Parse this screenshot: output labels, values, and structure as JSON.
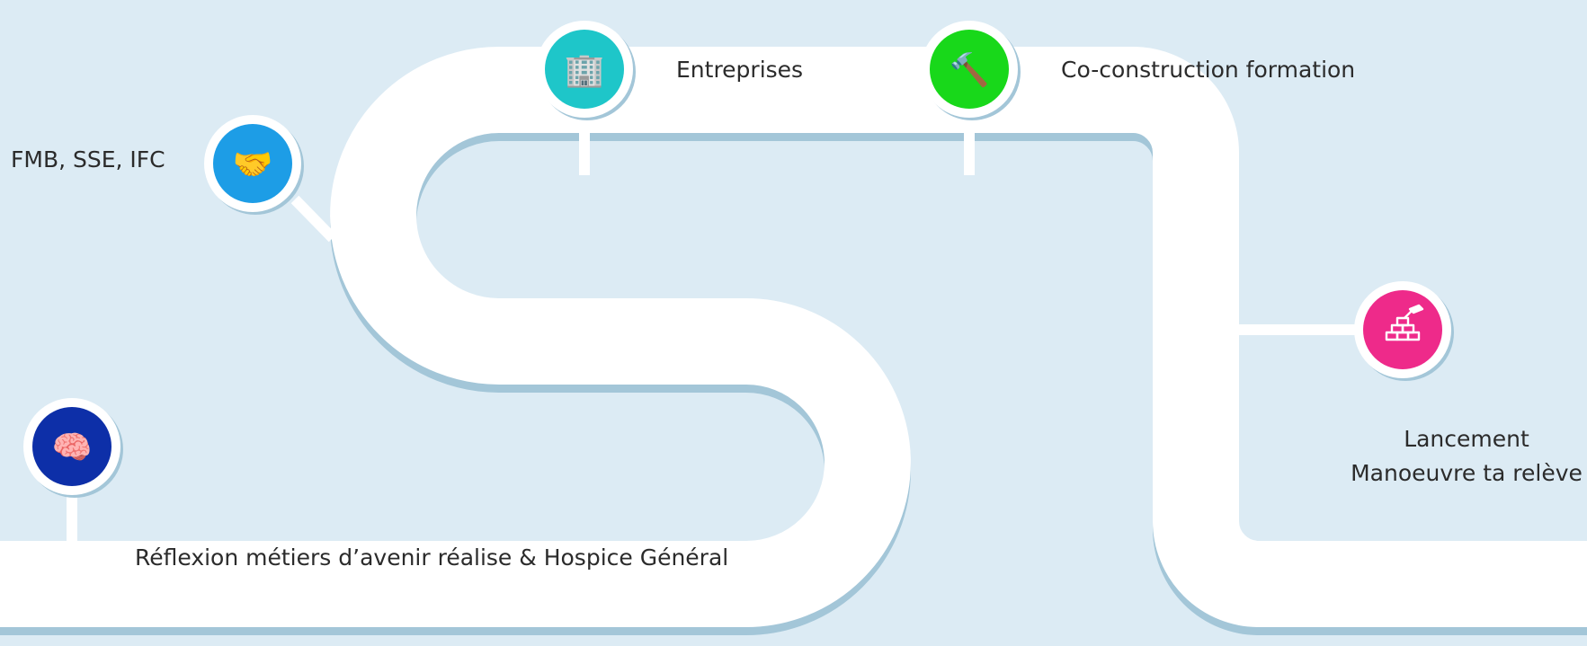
{
  "milestones": [
    {
      "id": "reflexion",
      "icon": "brain-icon",
      "emoji": "🧠",
      "color": "#0d2fa8",
      "label_lines": [
        "Réflexion métiers d’avenir réalise & Hospice Général"
      ]
    },
    {
      "id": "partners",
      "icon": "handshake-icon",
      "emoji": "🤝",
      "color": "#1d9de6",
      "label_lines": [
        "FMB, SSE, IFC"
      ]
    },
    {
      "id": "entreprises",
      "icon": "office-building-icon",
      "emoji": "🏢",
      "color": "#1ec6c9",
      "label_lines": [
        "Entreprises"
      ]
    },
    {
      "id": "co-construction",
      "icon": "hammer-icon",
      "emoji": "🔨",
      "color": "#18d81a",
      "label_lines": [
        "Co-construction formation"
      ]
    },
    {
      "id": "lancement",
      "icon": "bricks-trowel-icon",
      "emoji": "",
      "color": "#ee2a8a",
      "label_lines": [
        "Lancement",
        "Manoeuvre ta relève"
      ]
    }
  ],
  "colors": {
    "background": "#dcebf4",
    "road": "#ffffff",
    "road_shadow": "#a3c6d8"
  }
}
